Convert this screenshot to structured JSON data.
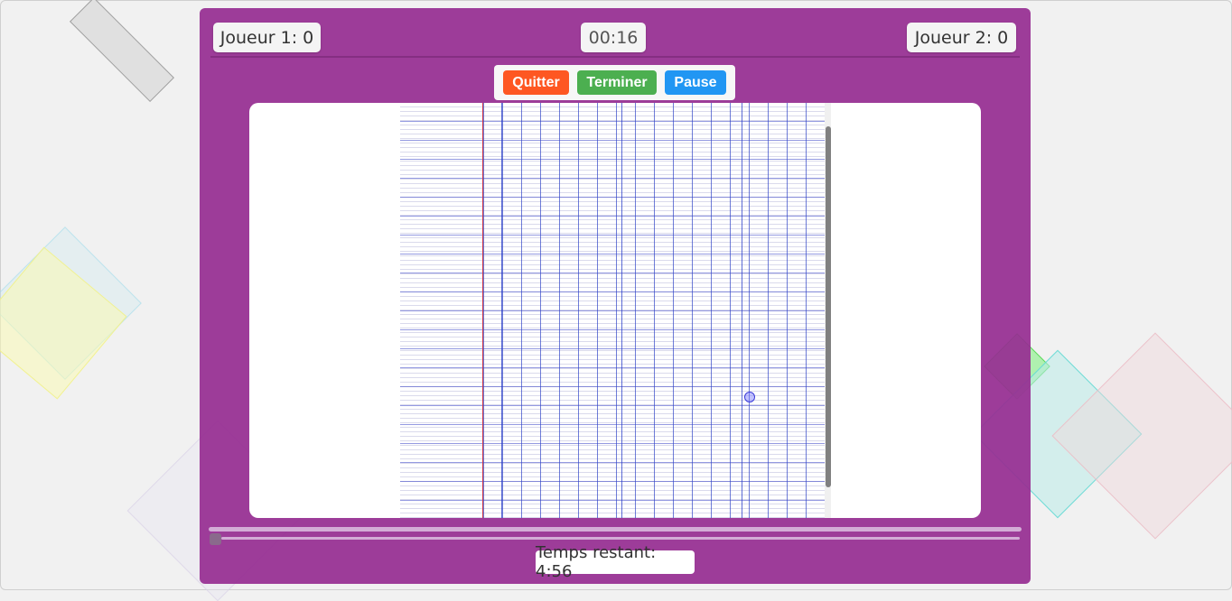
{
  "scoreboard": {
    "player1": "Joueur 1: 0",
    "timer": "00:16",
    "player2": "Joueur 2: 0"
  },
  "controls": {
    "quit_label": "Quitter",
    "finish_label": "Terminer",
    "pause_label": "Pause"
  },
  "footer": {
    "remaining_label": "Temps restant: 4:56"
  },
  "slider": {
    "progress": 0.0
  },
  "colors": {
    "panel": "#962d91",
    "quit": "#fe5722",
    "finish": "#4caf50",
    "pause": "#2196f3",
    "margin_line": "#d33a4a",
    "grid_line": "#3246c8"
  }
}
